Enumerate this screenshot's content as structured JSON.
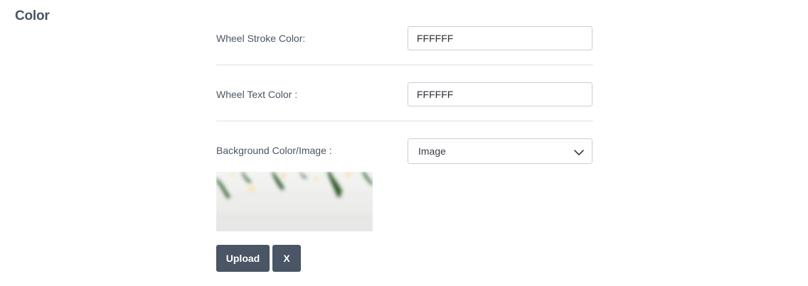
{
  "section": {
    "title": "Color"
  },
  "wheel_stroke": {
    "label": "Wheel Stroke Color:",
    "value": "FFFFFF"
  },
  "wheel_text": {
    "label": "Wheel Text Color :",
    "value": "FFFFFF"
  },
  "background": {
    "label": "Background Color/Image :",
    "selected": "Image",
    "preview_icon": "image-preview"
  },
  "actions": {
    "upload_label": "Upload",
    "remove_label": "X"
  },
  "colors": {
    "button_bg": "#4a5565",
    "button_text": "#ffffff",
    "title": "#4a5565",
    "field_border": "#c9ced6",
    "divider": "#dcdfe4"
  }
}
